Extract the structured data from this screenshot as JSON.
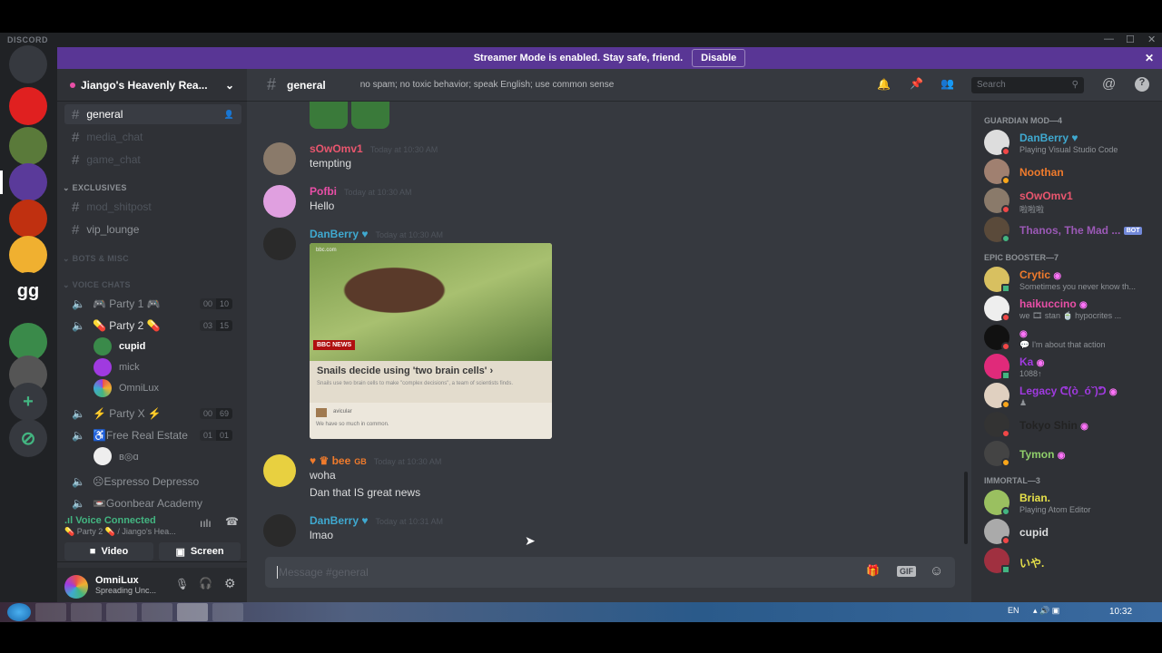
{
  "window": {
    "title": "DISCORD",
    "controls": [
      "minimize",
      "maximize",
      "close"
    ]
  },
  "banner": {
    "text": "Streamer Mode is enabled. Stay safe, friend.",
    "button": "Disable",
    "color": "#593695"
  },
  "servers": [
    {
      "label": "",
      "color": "#36393f",
      "icon": "discord-home-icon"
    },
    {
      "label": "",
      "color": "#e02020"
    },
    {
      "label": "",
      "color": "#5a7a3a"
    },
    {
      "label": "",
      "color": "#5a3a9a",
      "selected": true
    },
    {
      "label": "",
      "color": "#c03010"
    },
    {
      "label": "",
      "color": "#f0b030"
    },
    {
      "label": "gg",
      "color": "#202225"
    },
    {
      "label": "",
      "color": "#3a8a4a"
    },
    {
      "label": "",
      "color": "#555"
    }
  ],
  "guild": {
    "name": "Jiango's Heavenly Rea...",
    "channels": [
      {
        "name": "general",
        "selected": true
      },
      {
        "name": "media_chat",
        "muted": true
      },
      {
        "name": "game_chat",
        "muted": true
      }
    ],
    "cat_exclusives": "EXCLUSIVES",
    "exclusives": [
      {
        "name": "mod_shitpost",
        "muted": true
      },
      {
        "name": "vip_lounge"
      }
    ],
    "cat_bots": "BOTS & MISC",
    "cat_voice": "VOICE CHATS",
    "voice": [
      {
        "name": "🎮 Party 1 🎮",
        "count": [
          "00",
          "10"
        ]
      },
      {
        "name": "💊 Party 2 💊",
        "count": [
          "03",
          "15"
        ],
        "users": [
          "cupid",
          "mick",
          "OmniLux"
        ]
      },
      {
        "name": "⚡ Party X ⚡",
        "count": [
          "00",
          "69"
        ]
      },
      {
        "name": "♿Free Real Estate",
        "count": [
          "01",
          "01"
        ],
        "users": [
          "ʙ◎ɑ"
        ]
      },
      {
        "name": "☹Espresso Depresso"
      },
      {
        "name": "📼Goonbear Academy"
      }
    ]
  },
  "voice_status": {
    "title": "Voice Connected",
    "sub": "💊 Party 2 💊 / Jiango's Hea...",
    "video": "Video",
    "screen": "Screen",
    "color": "#43b581"
  },
  "user": {
    "name": "OmniLux",
    "status": "Spreading Unc..."
  },
  "chat": {
    "channel": "general",
    "topic": "no spam; no toxic behavior; speak English; use common sense",
    "search_placeholder": "Search",
    "input_placeholder": "Message #general",
    "messages": [
      {
        "author": "sOwOmv1",
        "color": "#e9566e",
        "time": "Today at 10:30 AM",
        "lines": [
          "tempting"
        ]
      },
      {
        "author": "Pofbi",
        "color": "#e94fa7",
        "time": "Today at 10:30 AM",
        "lines": [
          "Hello"
        ]
      },
      {
        "author": "DanBerry",
        "color": "#3fa9d0",
        "time": "Today at 10:30 AM",
        "lines": []
      },
      {
        "author": "bee",
        "badge": "GB",
        "color": "#f07b2c",
        "time": "Today at 10:30 AM",
        "lines": [
          "woha",
          "Dan that IS great news"
        ]
      },
      {
        "author": "DanBerry",
        "color": "#3fa9d0",
        "time": "Today at 10:31 AM",
        "lines": [
          "lmao"
        ]
      }
    ],
    "embed": {
      "provider": "bbc.com",
      "brand": "BBC NEWS",
      "title": "Snails decide using 'two brain cells'",
      "description": "Snails use two brain cells to make \"complex decisions\", a team of scientists finds.",
      "footer_author": "avicular",
      "footer_text": "We have so much in common."
    }
  },
  "members": {
    "groups": [
      {
        "title": "GUARDIAN MOD—4",
        "items": [
          {
            "name": "DanBerry",
            "color": "#3fa9d0",
            "status": "Playing Visual Studio Code",
            "presence": "dnd"
          },
          {
            "name": "Noothan",
            "color": "#f07b2c",
            "presence": "idle"
          },
          {
            "name": "sOwOmv1",
            "color": "#e9566e",
            "status": "啦啦啦",
            "presence": "dnd"
          },
          {
            "name": "Thanos, The Mad ...",
            "color": "#9b59b6",
            "bot": "BOT",
            "presence": "online"
          }
        ]
      },
      {
        "title": "EPIC BOOSTER—7",
        "items": [
          {
            "name": "Crytic",
            "color": "#f07b2c",
            "status": "Sometimes you never know th...",
            "presence": "mobile"
          },
          {
            "name": "haikuccino",
            "color": "#e94fa7",
            "status": "we 🎞 stan 🍵 hypocrites ...",
            "presence": "dnd"
          },
          {
            "name": "",
            "color": "#c0203a",
            "status": "💬 I'm about that action",
            "presence": "dnd"
          },
          {
            "name": "Ka",
            "color": "#a03ae0",
            "status": "1088↑",
            "presence": "mobile"
          },
          {
            "name": "Legacy ᕦ(ò_óˇ)ᕤ",
            "color": "#a03ae0",
            "status": "♟",
            "presence": "idle"
          },
          {
            "name": "Tokyo Shin",
            "color": "#222",
            "presence": "dnd"
          },
          {
            "name": "Tymon",
            "color": "#8fce6a",
            "presence": "idle"
          }
        ]
      },
      {
        "title": "IMMORTAL—3",
        "items": [
          {
            "name": "Brian.",
            "color": "#e6e04a",
            "status": "Playing Atom Editor",
            "presence": "online"
          },
          {
            "name": "cupid",
            "color": "#dcddde",
            "presence": "dnd"
          },
          {
            "name": "いや.",
            "color": "#e6e04a",
            "presence": "mobile"
          }
        ]
      }
    ]
  },
  "taskbar": {
    "lang": "EN",
    "clock": "10:32"
  }
}
